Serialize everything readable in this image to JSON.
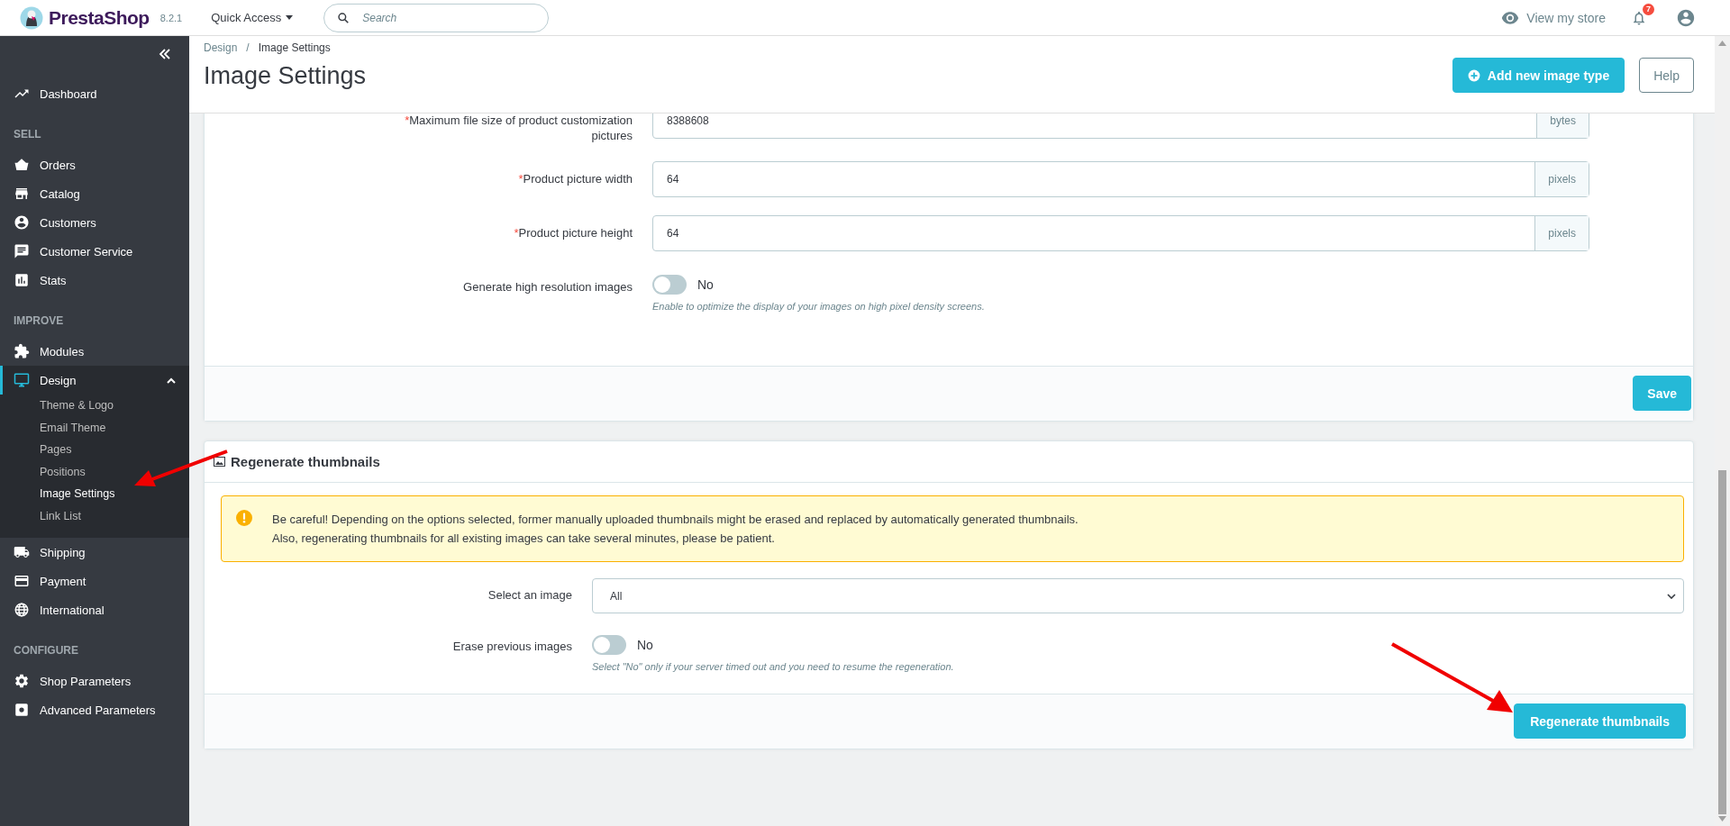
{
  "header": {
    "logo": "PrestaShop",
    "version": "8.2.1",
    "quick_access": "Quick Access",
    "search": {
      "placeholder": "Search"
    },
    "view_store": "View my store",
    "notifications": "7"
  },
  "sidebar": {
    "sections": [
      {
        "items": [
          {
            "label": "Dashboard",
            "selected": false
          }
        ]
      },
      {
        "title": "SELL",
        "items": [
          {
            "label": "Orders",
            "selected": false
          },
          {
            "label": "Catalog",
            "selected": false
          },
          {
            "label": "Customers",
            "selected": false
          },
          {
            "label": "Customer Service",
            "selected": false
          },
          {
            "label": "Stats",
            "selected": false
          }
        ]
      },
      {
        "title": "IMPROVE",
        "items": [
          {
            "label": "Modules",
            "selected": false
          },
          {
            "label": "Design",
            "selected": true,
            "expanded": true,
            "children": [
              {
                "label": "Theme & Logo",
                "selected": false
              },
              {
                "label": "Email Theme",
                "selected": false
              },
              {
                "label": "Pages",
                "selected": false
              },
              {
                "label": "Positions",
                "selected": false
              },
              {
                "label": "Image Settings",
                "selected": true
              },
              {
                "label": "Link List",
                "selected": false
              }
            ]
          },
          {
            "label": "Shipping",
            "selected": false
          },
          {
            "label": "Payment",
            "selected": false
          },
          {
            "label": "International",
            "selected": false
          }
        ]
      },
      {
        "title": "CONFIGURE",
        "items": [
          {
            "label": "Shop Parameters",
            "selected": false
          },
          {
            "label": "Advanced Parameters",
            "selected": false
          }
        ]
      }
    ]
  },
  "required_mark": "*",
  "page": {
    "breadcrumb": [
      "Design",
      "Image Settings"
    ],
    "breadcrumb_separator": "/",
    "title": "Image Settings",
    "actions": [
      {
        "label": "Add new image type",
        "kind": "primary"
      },
      {
        "label": "Help",
        "kind": "outline"
      }
    ]
  },
  "settings": {
    "fields": [
      {
        "kind": "input",
        "label": "Maximum file size of product customization pictures",
        "required": true,
        "value": "8388608",
        "suffix": "bytes"
      },
      {
        "kind": "input",
        "label": "Product picture width",
        "required": true,
        "value": "64",
        "suffix": "pixels"
      },
      {
        "kind": "input",
        "label": "Product picture height",
        "required": true,
        "value": "64",
        "suffix": "pixels"
      },
      {
        "kind": "switch",
        "label": "Generate high resolution images",
        "required": false,
        "on": false,
        "state_label": "No",
        "help": "Enable to optimize the display of your images on high pixel density screens."
      }
    ],
    "save": "Save"
  },
  "regenerate": {
    "title": "Regenerate thumbnails",
    "alert": [
      "Be careful! Depending on the options selected, former manually uploaded thumbnails might be erased and replaced by automatically generated thumbnails.",
      "Also, regenerating thumbnails for all existing images can take several minutes, please be patient."
    ],
    "fields": [
      {
        "kind": "select",
        "label": "Select an image",
        "required": false,
        "value": "All"
      },
      {
        "kind": "switch",
        "label": "Erase previous images",
        "required": false,
        "on": false,
        "state_label": "No",
        "help": "Select \"No\" only if your server timed out and you need to resume the regeneration."
      }
    ],
    "button": "Regenerate thumbnails"
  }
}
